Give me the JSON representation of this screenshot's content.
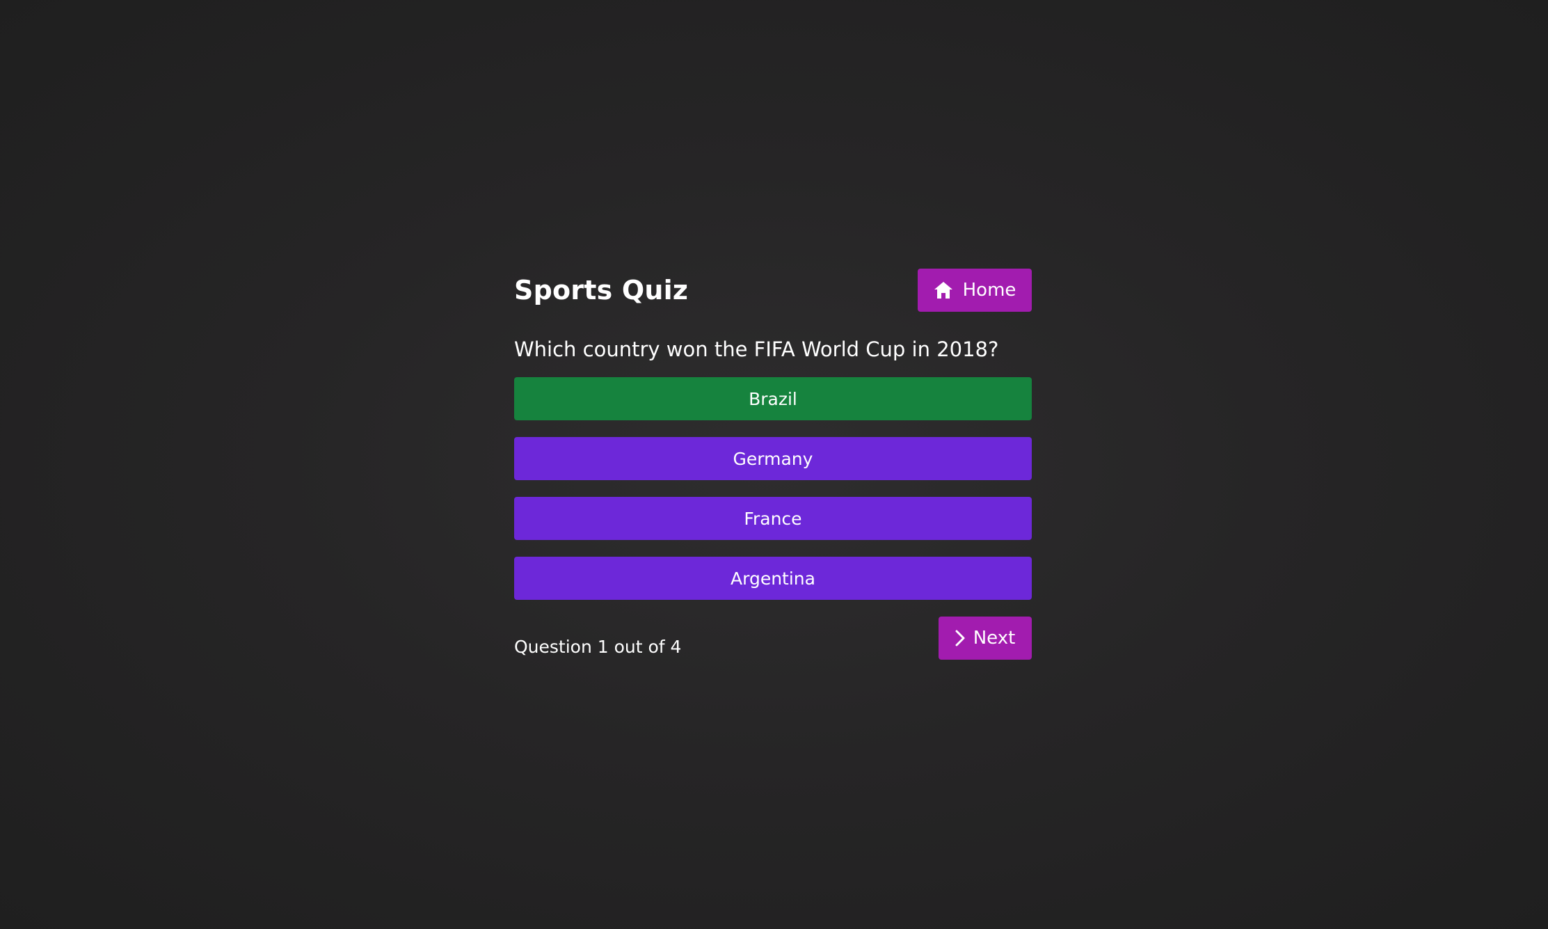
{
  "quiz": {
    "title": "Sports Quiz",
    "home_label": "Home",
    "home_icon": "home-icon",
    "question": "Which country won the FIFA World Cup in 2018?",
    "answers": [
      {
        "label": "Brazil",
        "color": "#16833e"
      },
      {
        "label": "Germany",
        "color": "#6d28d9"
      },
      {
        "label": "France",
        "color": "#6d28d9"
      },
      {
        "label": "Argentina",
        "color": "#6d28d9"
      }
    ],
    "progress_text": "Question 1 out of 4",
    "next_label": "Next",
    "next_icon": "chevron-right-icon"
  },
  "colors": {
    "accent": "#a21caf",
    "answer_default": "#6d28d9",
    "answer_selected": "#16833e",
    "background": "#262526"
  }
}
